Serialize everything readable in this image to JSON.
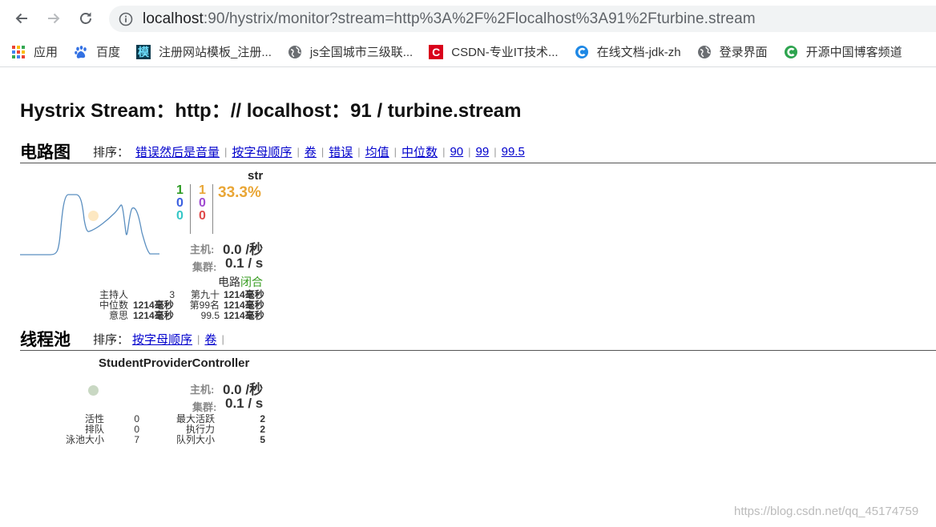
{
  "browser": {
    "url_host": "localhost",
    "url_rest": ":90/hystrix/monitor?stream=http%3A%2F%2Flocalhost%3A91%2Fturbine.stream",
    "bookmarks": [
      {
        "label": "应用",
        "icon": "apps-grid-icon"
      },
      {
        "label": "百度",
        "icon": "baidu-paw-icon"
      },
      {
        "label": "注册网站模板_注册...",
        "icon": "mo-template-icon",
        "glyph": "模"
      },
      {
        "label": "js全国城市三级联...",
        "icon": "globe-icon"
      },
      {
        "label": "CSDN-专业IT技术...",
        "icon": "csdn-icon",
        "glyph": "C"
      },
      {
        "label": "在线文档-jdk-zh",
        "icon": "c-doc-icon"
      },
      {
        "label": "登录界面",
        "icon": "globe-icon"
      },
      {
        "label": "开源中国博客频道",
        "icon": "oschina-icon",
        "glyph": "C"
      }
    ]
  },
  "page": {
    "title": "Hystrix Stream：http：// localhost：91 / turbine.stream"
  },
  "circuit": {
    "heading": "电路图",
    "sort_label": "排序：",
    "sort_links": [
      "错误然后是音量",
      "按字母顺序",
      "卷",
      "错误",
      "均值",
      "中位数",
      "90",
      "99",
      "99.5"
    ],
    "card": {
      "name": "str",
      "counts_left": [
        "1",
        "0",
        "0"
      ],
      "counts_right": [
        "1",
        "0",
        "0"
      ],
      "error_pct": "33.3%",
      "host_label": "主机:",
      "host_rate": "0.0 /秒",
      "cluster_label": "集群:",
      "cluster_rate": "0.1 / s",
      "circuit_label": "电路",
      "circuit_state": "闭合",
      "stats": {
        "hosts_label": "主持人",
        "hosts_value": "3",
        "p90_label": "第九十",
        "p90_value": "1214毫秒",
        "median_label": "中位数",
        "median_value": "1214毫秒",
        "p99_label": "第99名",
        "p99_value": "1214毫秒",
        "mean_label": "意思",
        "mean_value": "1214毫秒",
        "p995_label": "99.5",
        "p995_value": "1214毫秒"
      }
    }
  },
  "threadpool": {
    "heading": "线程池",
    "sort_label": "排序：",
    "sort_links": [
      "按字母顺序",
      "卷"
    ],
    "card": {
      "name": "StudentProviderController",
      "host_label": "主机:",
      "host_rate": "0.0 /秒",
      "cluster_label": "集群:",
      "cluster_rate": "0.1 / s",
      "stats": {
        "active_label": "活性",
        "active_value": "0",
        "max_active_label": "最大活跃",
        "max_active_value": "2",
        "queued_label": "排队",
        "queued_value": "0",
        "executions_label": "执行力",
        "executions_value": "2",
        "pool_size_label": "泳池大小",
        "pool_size_value": "7",
        "queue_size_label": "队列大小",
        "queue_size_value": "5"
      }
    }
  },
  "colors": {
    "success": "#2d9b23",
    "short_circuited": "#3b5fe0",
    "bad_request": "#35c7c7",
    "timeout": "#e9a636",
    "rejected": "#a04bd1",
    "failure": "#e04b4b",
    "sparkline": "#5b8fc0",
    "circuit_bubble": "#fde8c2",
    "pool_bubble": "#c9d8c3"
  },
  "watermark": "https://blog.csdn.net/qq_45174759"
}
